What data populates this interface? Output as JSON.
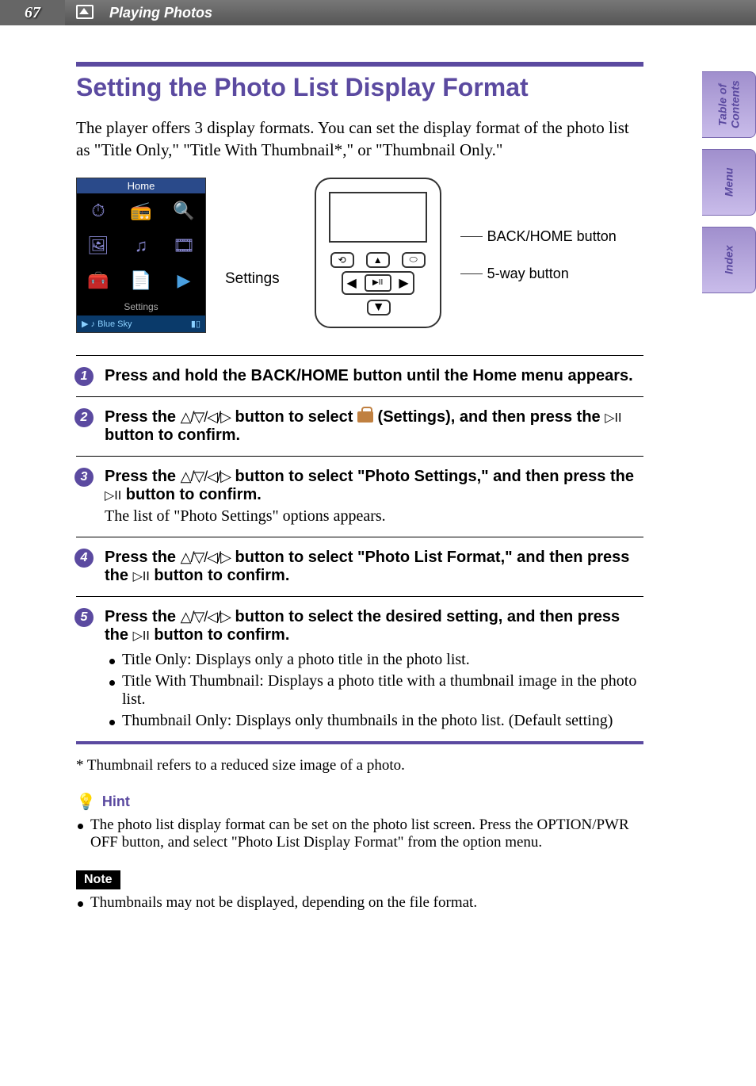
{
  "header": {
    "page_number": "67",
    "section": "Playing Photos"
  },
  "side_tabs": [
    "Table of Contents",
    "Menu",
    "Index"
  ],
  "title": "Setting the Photo List Display Format",
  "intro": "The player offers 3 display formats. You can set the display format of the photo list as \"Title Only,\" \"Title With Thumbnail*,\" or \"Thumbnail Only.\"",
  "home_screen": {
    "title": "Home",
    "settings_label": "Settings",
    "now_playing": "Blue Sky"
  },
  "settings_callout": "Settings",
  "device_labels": {
    "back_home": "BACK/HOME button",
    "five_way": "5-way button"
  },
  "steps": [
    {
      "num": "1",
      "head": "Press and hold the BACK/HOME button until the Home menu appears."
    },
    {
      "num": "2",
      "head_prefix": "Press the ",
      "head_mid": " button to select ",
      "head_suffix": " (Settings), and then press the ",
      "head_end": " button to confirm."
    },
    {
      "num": "3",
      "head_prefix": "Press the ",
      "head_mid": " button to select \"Photo Settings,\" and then press the ",
      "head_end": " button to confirm.",
      "sub": "The list of \"Photo Settings\" options appears."
    },
    {
      "num": "4",
      "head_prefix": "Press the ",
      "head_mid": " button to select \"Photo List Format,\" and then press the ",
      "head_end": " button to confirm."
    },
    {
      "num": "5",
      "head_prefix": "Press the ",
      "head_mid": " button to select the desired setting, and then press the ",
      "head_end": " button to confirm.",
      "bullets": [
        "Title Only: Displays only a photo title in the photo list.",
        "Title With Thumbnail: Displays a photo title with a thumbnail image in the photo list.",
        "Thumbnail Only: Displays only thumbnails in the photo list. (Default setting)"
      ]
    }
  ],
  "footnote": "*  Thumbnail refers to a reduced size image of a photo.",
  "hint": {
    "label": "Hint",
    "body": "The photo list display format can be set on the photo list screen. Press the OPTION/PWR OFF button, and select \"Photo List Display Format\" from the option menu."
  },
  "note": {
    "label": "Note",
    "body": "Thumbnails may not be displayed, depending on the file format."
  },
  "symbols": {
    "nav": "△/▽/◁/▷",
    "play": "▷II"
  }
}
